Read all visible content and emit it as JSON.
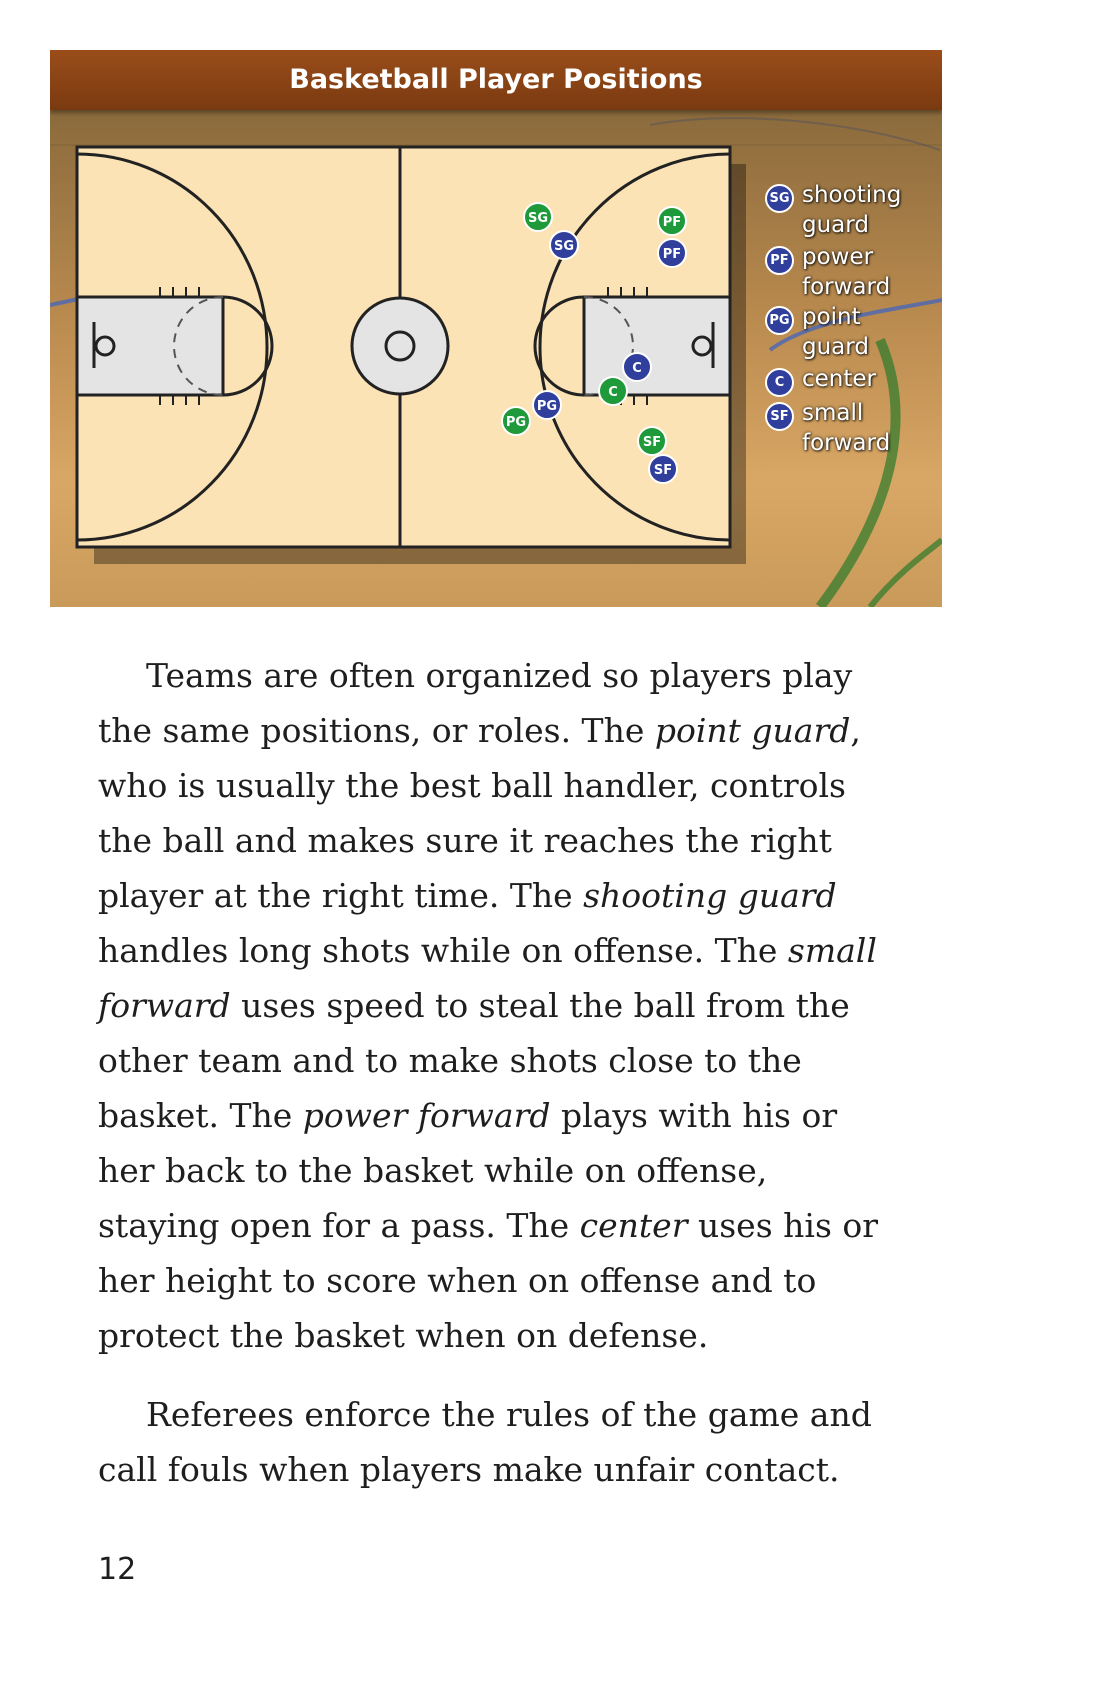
{
  "figure": {
    "title": "Basketball Player Positions",
    "legend": [
      {
        "abbr": "SG",
        "label": "shooting guard"
      },
      {
        "abbr": "PF",
        "label": "power forward"
      },
      {
        "abbr": "PG",
        "label": "point guard"
      },
      {
        "abbr": "C",
        "label": "center"
      },
      {
        "abbr": "SF",
        "label": "small forward"
      }
    ],
    "markers": {
      "green_team": [
        "SG",
        "PF",
        "C",
        "PG",
        "SF"
      ],
      "blue_team": [
        "SG",
        "PF",
        "C",
        "PG",
        "SF"
      ]
    },
    "colors": {
      "header": "#8a4416",
      "green_team": "#1f9a3a",
      "blue_team": "#2f3f9b",
      "court": "#fbe3b6",
      "key": "#e4e4e4"
    }
  },
  "body": {
    "p1": {
      "s1": "Teams are often organized so players play the same positions, or roles. The ",
      "t1": "point guard",
      "s2": ", who is usually the best ball handler, controls the ball and makes sure it reaches the right player at the right time. The ",
      "t2": "shooting guard",
      "s3": " handles long shots while on offense. The ",
      "t3": "small forward",
      "s4": " uses speed to steal the ball from the other team and to make shots close to the basket. The ",
      "t4": "power forward",
      "s5": " plays with his or her back to the basket while on offense, staying open for a pass. The ",
      "t5": "center",
      "s6": " uses his or her height to score when on offense and to protect the basket when on defense."
    },
    "p2": "Referees enforce the rules of the game and call fouls when players make unfair contact."
  },
  "page_number": "12"
}
